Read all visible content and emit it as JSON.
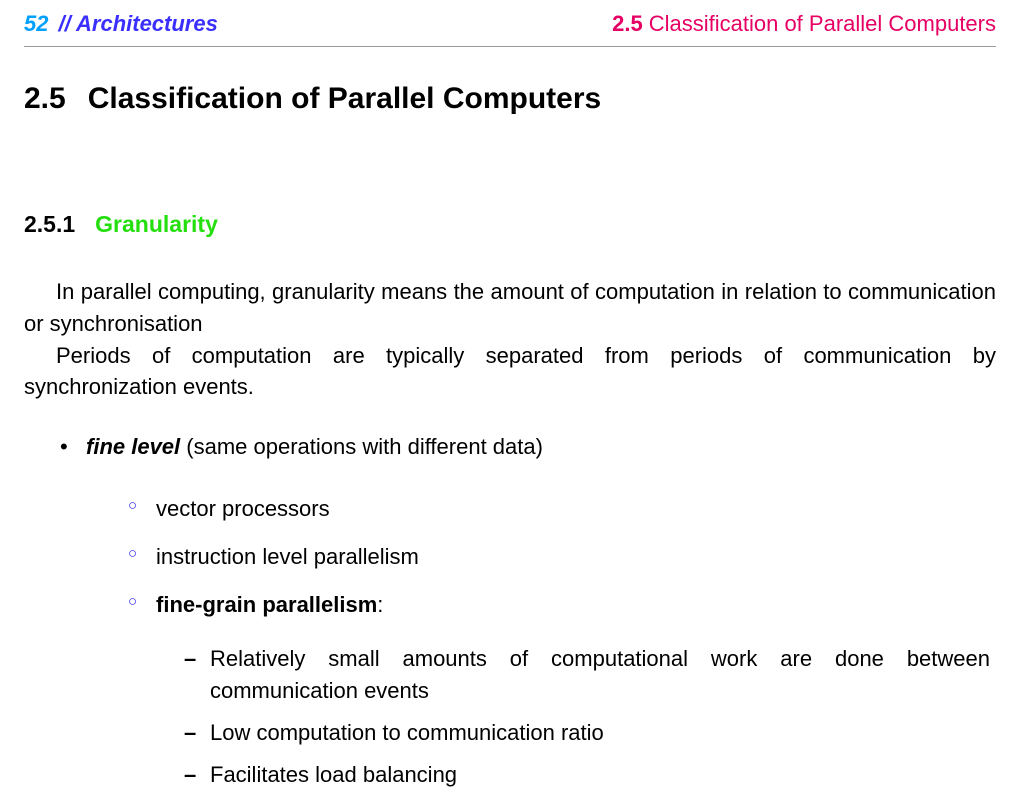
{
  "runningHead": {
    "pageNumber": "52",
    "chapterLabel": "// Architectures",
    "sectionNumber": "2.5",
    "sectionTitle": "Classification of Parallel Computers"
  },
  "section": {
    "number": "2.5",
    "title": "Classification of Parallel Computers"
  },
  "subsection": {
    "number": "2.5.1",
    "title": "Granularity"
  },
  "paragraphs": {
    "p1": "In parallel computing, granularity means the amount of computation in relation to communication or synchronisation",
    "p2": "Periods of computation are typically separated from periods of communication by synchronization events."
  },
  "bullets": {
    "fineLevel": {
      "label": "fine level",
      "suffix": " (same operations with different data)",
      "items": {
        "vp": "vector processors",
        "ilp": "instruction level parallelism",
        "fgp": {
          "label": "fine-grain parallelism",
          "colon": ":"
        }
      },
      "dash": {
        "d1": "Relatively small amounts of computational work are done between communication events",
        "d2": "Low computation to communication ratio",
        "d3": "Facilitates load balancing"
      }
    }
  }
}
